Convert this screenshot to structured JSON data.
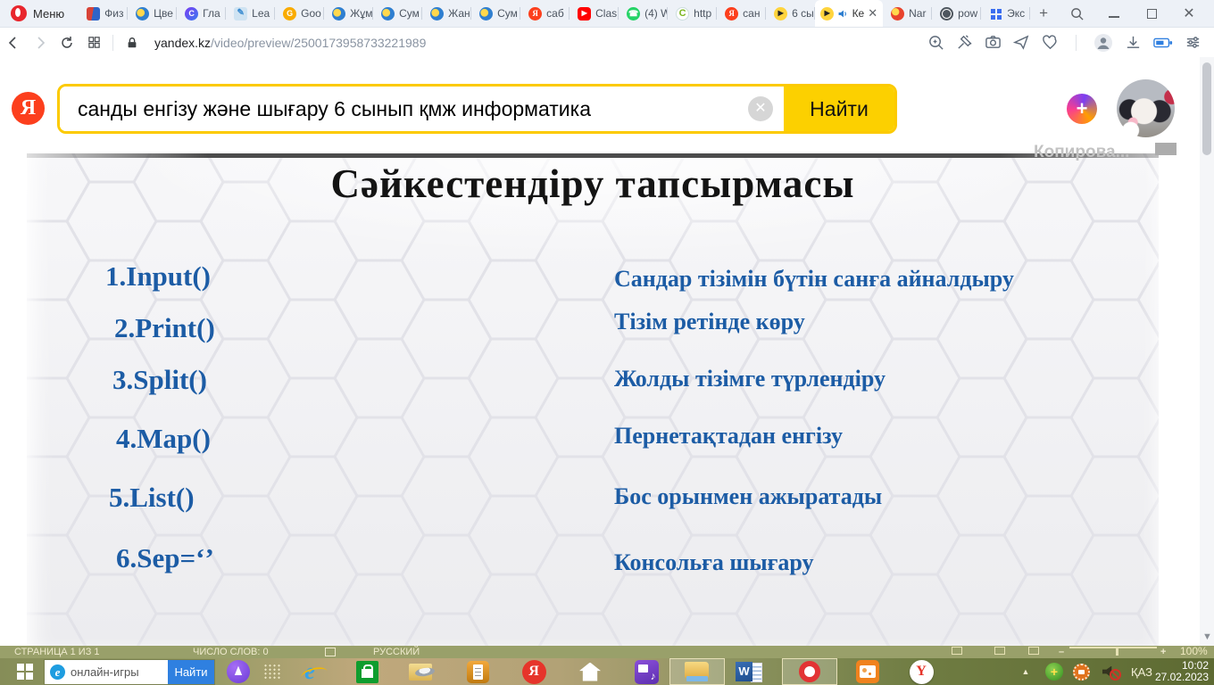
{
  "browser": {
    "menu_label": "Меню",
    "tabs": [
      {
        "label": "Физ",
        "icon": "book-icon"
      },
      {
        "label": "Цве",
        "icon": "hand-icon"
      },
      {
        "label": "Гла",
        "icon": "c-badge-icon"
      },
      {
        "label": "Lea",
        "icon": "learning-apps-icon"
      },
      {
        "label": "Goo",
        "icon": "google-dot-icon"
      },
      {
        "label": "Жұм",
        "icon": "hand-icon"
      },
      {
        "label": "Сум",
        "icon": "hand-icon"
      },
      {
        "label": "Жан",
        "icon": "hand-icon"
      },
      {
        "label": "Сум",
        "icon": "hand-icon"
      },
      {
        "label": "саб",
        "icon": "yandex-icon"
      },
      {
        "label": "Clas",
        "icon": "youtube-icon"
      },
      {
        "label": "(4) W",
        "icon": "whatsapp-icon"
      },
      {
        "label": "http",
        "icon": "green-c-icon"
      },
      {
        "label": "сан",
        "icon": "yandex-icon"
      },
      {
        "label": "6 сы",
        "icon": "video-play-icon"
      }
    ],
    "active_tab": {
      "label": "Ке",
      "icon": "video-play-icon",
      "sound_on": true
    },
    "tabs_after": [
      {
        "label": "Nar",
        "icon": "parrot-icon"
      },
      {
        "label": "pow",
        "icon": "globe-icon"
      },
      {
        "label": "Экс",
        "icon": "blue-grid-icon"
      }
    ],
    "new_tab_glyph": "+",
    "window_icons": [
      "search",
      "minimize",
      "restore",
      "close"
    ],
    "address": {
      "domain": "yandex.kz",
      "path": "/video/preview/2500173958733221989"
    },
    "address_left_icons": [
      "back",
      "forward",
      "reload",
      "speed-dial",
      "lock"
    ],
    "address_right_icons": [
      "zoom-in",
      "pin",
      "snapshot",
      "send",
      "heart",
      "profile",
      "download",
      "battery-saver",
      "settings"
    ]
  },
  "search_header": {
    "query": "санды енгізу және шығару 6 сынып қмж информатика",
    "button": "Найти",
    "icons": [
      "yandex-logo",
      "clear",
      "plus-badge",
      "avatar"
    ]
  },
  "slide": {
    "title": "Сәйкестендіру тапсырмасы",
    "watermark": "Копирова...",
    "left_items": [
      "1.Input()",
      "2.Print()",
      "3.Split()",
      "4.Map()",
      "5.List()",
      "6.Sep=‘’"
    ],
    "right_items": [
      "Сандар тізімін бүтін санға айналдыру",
      "Тізім ретінде көру",
      "Жолды тізімге түрлендіру",
      "Пернетақтадан енгізу",
      "Бос орынмен ажыратады",
      "Консольға шығару"
    ]
  },
  "word_status": {
    "page": "СТРАНИЦА 1 ИЗ 1",
    "words": "ЧИСЛО СЛОВ: 0",
    "lang": "РУССКИЙ",
    "zoom": "100%",
    "view_icons": [
      "read-mode",
      "print-layout",
      "web-layout"
    ]
  },
  "taskbar": {
    "search_value": "онлайн-игры",
    "search_button": "Найти",
    "apps": [
      "start",
      "edge-search",
      "alice",
      "task-view",
      "internet-explorer",
      "store",
      "file-manager",
      "notes",
      "yandex",
      "home",
      "media-player",
      "file-explorer",
      "word",
      "opera",
      "photos",
      "yandex-browser"
    ],
    "tray": {
      "lang": "ҚАЗ",
      "time": "10:02",
      "date": "27.02.2023"
    }
  },
  "colors": {
    "yandex_red": "#fc3f1d",
    "search_border": "#fcca00",
    "find_button": "#fcd000",
    "slide_text_blue": "#1c5ca5",
    "taskbar_olive": "#8d9360",
    "taskbar_find_blue": "#2f80e0"
  }
}
